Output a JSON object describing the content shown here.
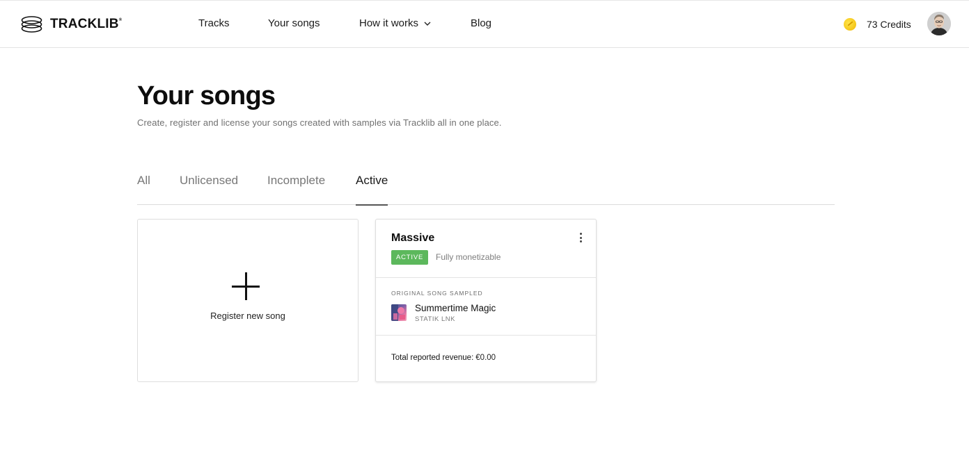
{
  "header": {
    "logo_text": "TRACKLIB",
    "logo_reg": "®",
    "nav": {
      "tracks": "Tracks",
      "your_songs": "Your songs",
      "how_it_works": "How it works",
      "blog": "Blog"
    },
    "credits": "73 Credits",
    "icons": {
      "logo": "tracklib-logo-icon",
      "dropdown": "chevron-down-icon",
      "coin": "credit-coin-icon",
      "avatar": "user-avatar"
    }
  },
  "main": {
    "title": "Your songs",
    "subtitle": "Create, register and license your songs created with samples via Tracklib all in one place.",
    "tabs": [
      {
        "label": "All",
        "active": false
      },
      {
        "label": "Unlicensed",
        "active": false
      },
      {
        "label": "Incomplete",
        "active": false
      },
      {
        "label": "Active",
        "active": true
      }
    ],
    "new_song_card": {
      "label": "Register new song",
      "icon": "plus-icon"
    },
    "song_card": {
      "title": "Massive",
      "status_badge": "ACTIVE",
      "status_note": "Fully monetizable",
      "original_label": "ORIGINAL SONG SAMPLED",
      "original_title": "Summertime Magic",
      "original_artist": "STATIK LNK",
      "revenue_label": "Total reported revenue:",
      "revenue_value": "€0.00",
      "menu_icon": "kebab-menu-icon"
    }
  },
  "colors": {
    "badge_green": "#5cb85c",
    "coin_yellow": "#f5c518",
    "text_primary": "#111111",
    "text_muted": "#707070"
  }
}
